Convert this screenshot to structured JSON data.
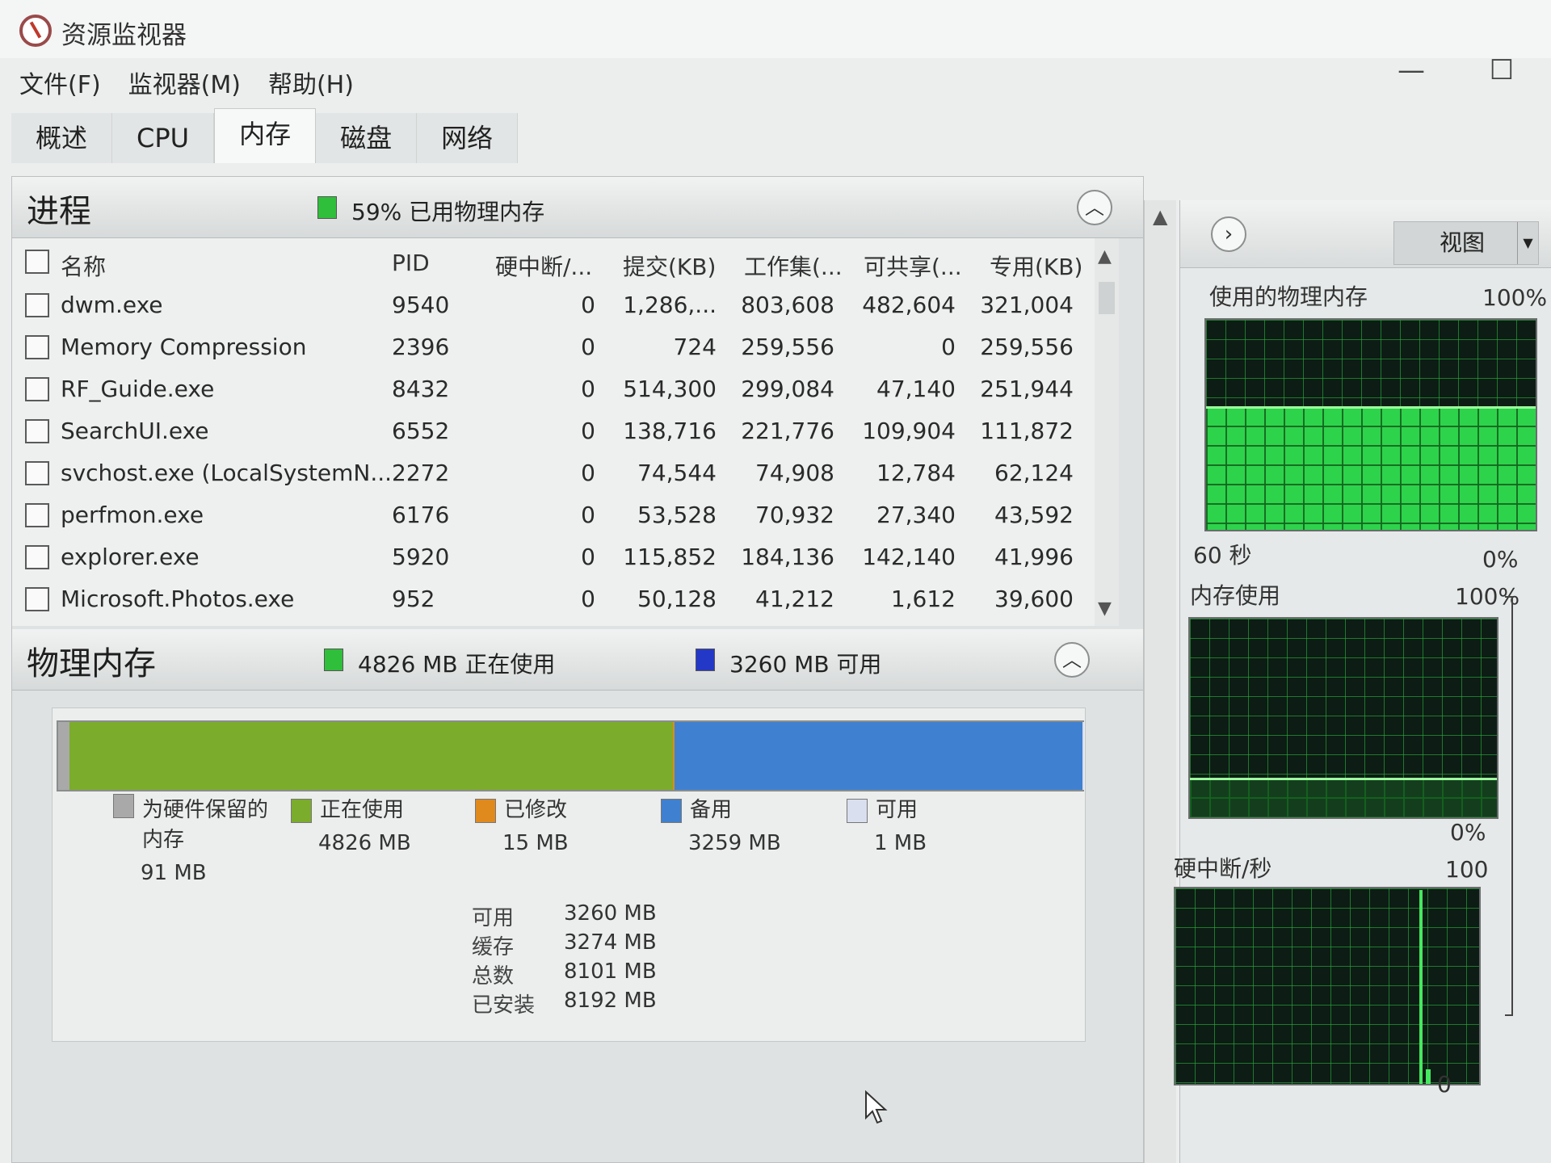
{
  "window": {
    "title": "资源监视器"
  },
  "menu": [
    "文件(F)",
    "监视器(M)",
    "帮助(H)"
  ],
  "tabs": [
    "概述",
    "CPU",
    "内存",
    "磁盘",
    "网络"
  ],
  "active_tab": "内存",
  "window_controls": {
    "minimize": "—",
    "maximize": "☐"
  },
  "processes": {
    "title": "进程",
    "summary": "59% 已用物理内存",
    "summary_color": "#2fbf3a",
    "columns": [
      "名称",
      "PID",
      "硬中断/...",
      "提交(KB)",
      "工作集(...",
      "可共享(...",
      "专用(KB)"
    ],
    "rows": [
      [
        "dwm.exe",
        "9540",
        "0",
        "1,286,...",
        "803,608",
        "482,604",
        "321,004"
      ],
      [
        "Memory Compression",
        "2396",
        "0",
        "724",
        "259,556",
        "0",
        "259,556"
      ],
      [
        "RF_Guide.exe",
        "8432",
        "0",
        "514,300",
        "299,084",
        "47,140",
        "251,944"
      ],
      [
        "SearchUI.exe",
        "6552",
        "0",
        "138,716",
        "221,776",
        "109,904",
        "111,872"
      ],
      [
        "svchost.exe (LocalSystemN...",
        "2272",
        "0",
        "74,544",
        "74,908",
        "12,784",
        "62,124"
      ],
      [
        "perfmon.exe",
        "6176",
        "0",
        "53,528",
        "70,932",
        "27,340",
        "43,592"
      ],
      [
        "explorer.exe",
        "5920",
        "0",
        "115,852",
        "184,136",
        "142,140",
        "41,996"
      ],
      [
        "Microsoft.Photos.exe",
        "952",
        "0",
        "50,128",
        "41,212",
        "1,612",
        "39,600"
      ]
    ]
  },
  "physical_memory": {
    "title": "物理内存",
    "in_use_text": "4826 MB 正在使用",
    "available_text": "3260 MB 可用",
    "in_use_color": "#2fbf3a",
    "available_color": "#2438c8",
    "bar": {
      "reserved_mb": 91,
      "in_use_mb": 4826,
      "modified_mb": 15,
      "standby_mb": 3259,
      "free_mb": 1
    },
    "legend": [
      {
        "label": "为硬件保留的\n内存",
        "value": "91 MB",
        "color": "#a9a9a9"
      },
      {
        "label": "正在使用",
        "value": "4826 MB",
        "color": "#7cac2c"
      },
      {
        "label": "已修改",
        "value": "15 MB",
        "color": "#e08a1e"
      },
      {
        "label": "备用",
        "value": "3259 MB",
        "color": "#3f80d0"
      },
      {
        "label": "可用",
        "value": "1 MB",
        "color": "#d9dfef"
      }
    ],
    "summary": [
      {
        "k": "可用",
        "v": "3260 MB"
      },
      {
        "k": "缓存",
        "v": "3274 MB"
      },
      {
        "k": "总数",
        "v": "8101 MB"
      },
      {
        "k": "已安装",
        "v": "8192 MB"
      }
    ]
  },
  "graphs": {
    "view_label": "视图",
    "g1": {
      "label": "使用的物理内存",
      "max": "100%",
      "duration": "60 秒",
      "min": "0%",
      "fill_fraction": 0.59
    },
    "g2": {
      "label": "内存使用",
      "max": "100%",
      "min": "0%",
      "fill_fraction": 0.2
    },
    "g3": {
      "label": "硬中断/秒",
      "max": "100",
      "min": "0"
    }
  },
  "icons": {
    "collapse": "chevron-up-icon",
    "nav": "chevron-right-icon",
    "scroll_up": "arrow-up-icon",
    "scroll_down": "arrow-down-icon"
  }
}
